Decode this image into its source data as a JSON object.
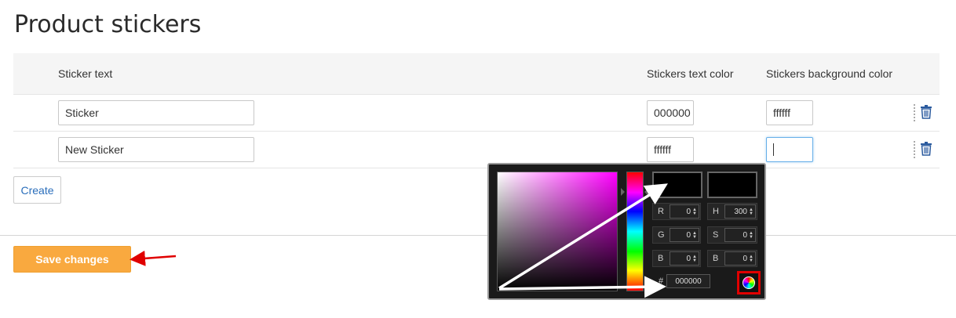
{
  "page": {
    "title": "Product stickers"
  },
  "table": {
    "headers": {
      "sticker_text": "Sticker text",
      "text_color": "Stickers text color",
      "background_color": "Stickers background color"
    },
    "rows": [
      {
        "sticker_text": "Sticker",
        "text_color": "000000",
        "background_color": "ffffff"
      },
      {
        "sticker_text": "New Sticker",
        "text_color": "ffffff",
        "background_color": ""
      }
    ]
  },
  "actions": {
    "create_label": "Create",
    "save_label": "Save changes"
  },
  "color_picker": {
    "labels": {
      "r": "R",
      "g": "G",
      "b": "B",
      "h": "H",
      "s": "S",
      "b2": "B",
      "hash": "#"
    },
    "values": {
      "r": "0",
      "g": "0",
      "b": "0",
      "h": "300",
      "s": "0",
      "b2": "0",
      "hex": "000000"
    },
    "hue_color": "#ff00ff",
    "new_color": "#000000",
    "current_color": "#000000"
  },
  "colors": {
    "accent": "#f9a93f",
    "link": "#2a6ebb",
    "annotation_white": "#ffffff",
    "annotation_red": "#e00000"
  }
}
